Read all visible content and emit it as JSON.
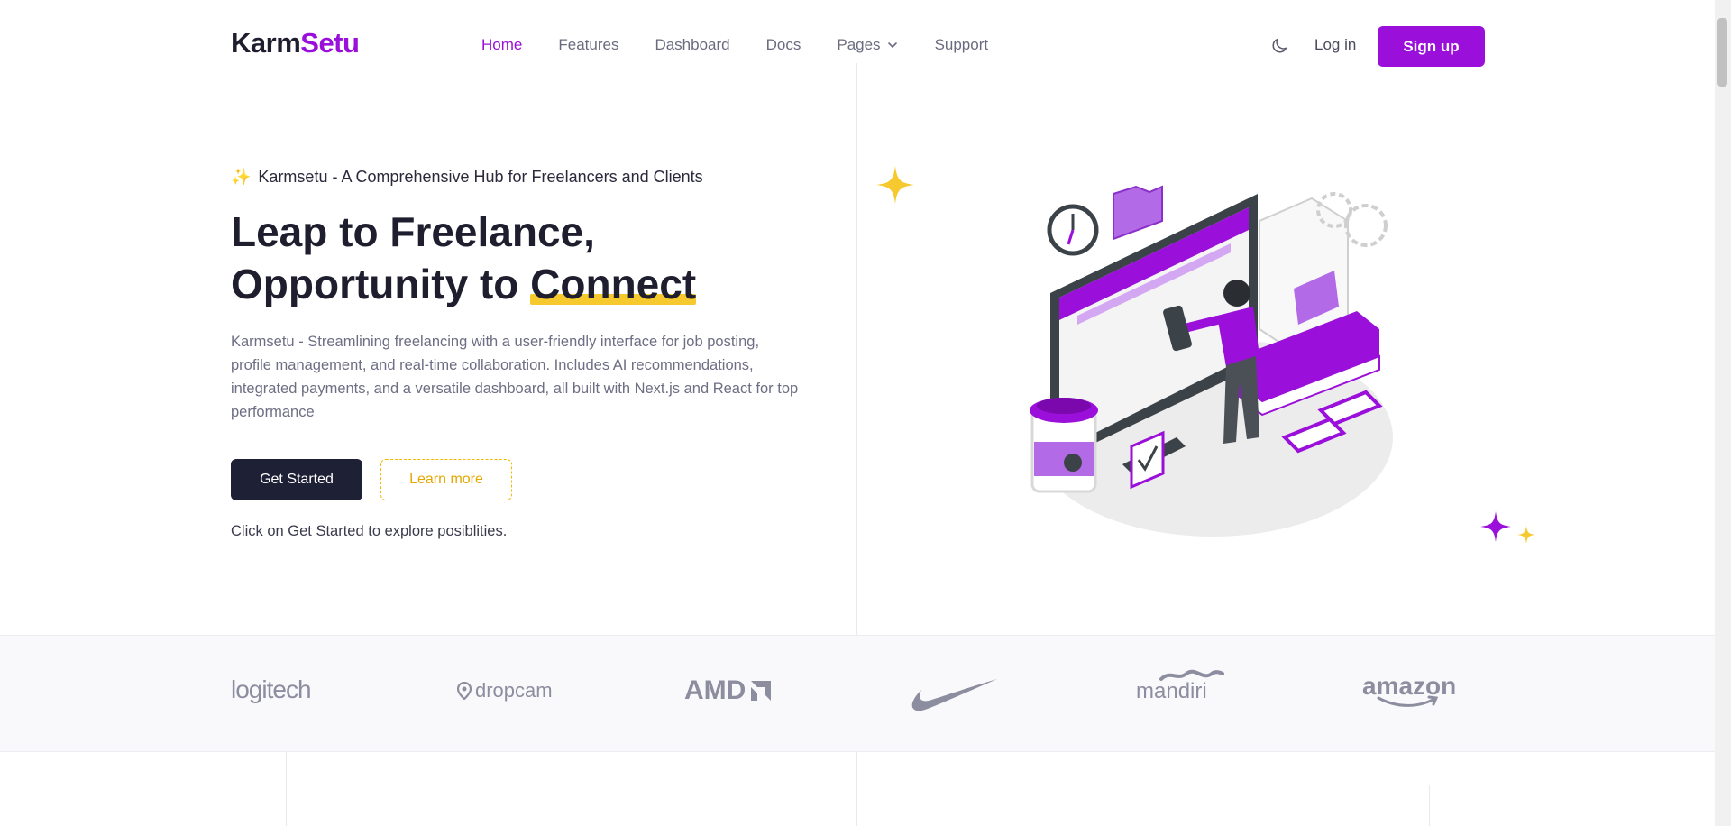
{
  "brand": {
    "part1": "Karm",
    "part2": "Setu"
  },
  "nav": {
    "items": [
      {
        "label": "Home",
        "active": true
      },
      {
        "label": "Features"
      },
      {
        "label": "Dashboard"
      },
      {
        "label": "Docs"
      },
      {
        "label": "Pages",
        "dropdown": true
      },
      {
        "label": "Support"
      }
    ]
  },
  "header": {
    "theme_toggle_icon": "moon-icon",
    "login_label": "Log in",
    "signup_label": "Sign up"
  },
  "hero": {
    "badge_icon": "sparkles-icon",
    "badge_text": "Karmsetu - A Comprehensive Hub for Freelancers and Clients",
    "headline_line1": "Leap to Freelance,",
    "headline_line2_prefix": "Opportunity to ",
    "headline_highlight": "Connect",
    "description": "Karmsetu - Streamlining freelancing with a user-friendly interface for job posting, profile management, and real-time collaboration. Includes AI recommendations, integrated payments, and a versatile dashboard, all built with Next.js and React for top performance",
    "primary_button": "Get Started",
    "secondary_button": "Learn more",
    "hint": "Click on Get Started to explore posiblities."
  },
  "logos": [
    {
      "name": "logitech"
    },
    {
      "name": "dropcam"
    },
    {
      "name": "AMD"
    },
    {
      "name": "nike-swoosh"
    },
    {
      "name": "mandiri"
    },
    {
      "name": "amazon"
    }
  ],
  "colors": {
    "accent": "#9a0fd9",
    "dark": "#1e2035",
    "highlight": "#f6c92f"
  }
}
